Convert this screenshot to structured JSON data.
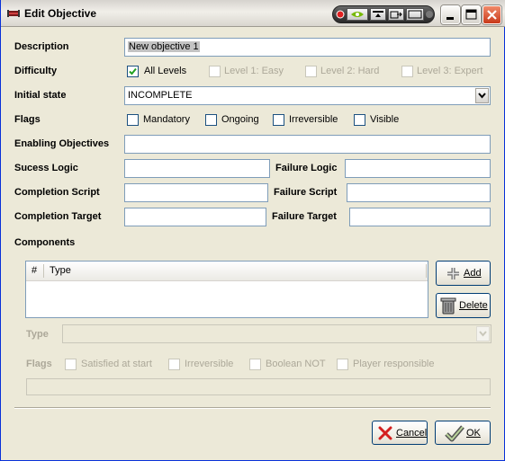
{
  "window": {
    "title": "Edit Objective"
  },
  "form": {
    "description": {
      "label": "Description",
      "value": "New objective 1"
    },
    "difficulty": {
      "label": "Difficulty",
      "options": [
        {
          "label": "All Levels",
          "checked": true,
          "enabled": true
        },
        {
          "label": "Level 1: Easy",
          "checked": false,
          "enabled": false
        },
        {
          "label": "Level 2: Hard",
          "checked": false,
          "enabled": false
        },
        {
          "label": "Level 3: Expert",
          "checked": false,
          "enabled": false
        }
      ]
    },
    "initial_state": {
      "label": "Initial state",
      "value": "INCOMPLETE"
    },
    "flags": {
      "label": "Flags",
      "options": [
        {
          "label": "Mandatory",
          "checked": false
        },
        {
          "label": "Ongoing",
          "checked": false
        },
        {
          "label": "Irreversible",
          "checked": false
        },
        {
          "label": "Visible",
          "checked": false
        }
      ]
    },
    "enabling_objectives": {
      "label": "Enabling Objectives",
      "value": ""
    },
    "success_logic": {
      "label": "Sucess Logic",
      "value": ""
    },
    "failure_logic": {
      "label": "Failure Logic",
      "value": ""
    },
    "completion_script": {
      "label": "Completion Script",
      "value": ""
    },
    "failure_script": {
      "label": "Failure Script",
      "value": ""
    },
    "completion_target": {
      "label": "Completion Target",
      "value": ""
    },
    "failure_target": {
      "label": "Failure Target",
      "value": ""
    }
  },
  "components": {
    "label": "Components",
    "columns": [
      "#",
      "Type"
    ],
    "rows": [],
    "add_button": "Add",
    "delete_button": "Delete",
    "type_label": "Type",
    "type_value": "",
    "flags_label": "Flags",
    "flag_options": [
      {
        "label": "Satisfied at start",
        "checked": false
      },
      {
        "label": "Irreversible",
        "checked": false
      },
      {
        "label": "Boolean NOT",
        "checked": false
      },
      {
        "label": "Player responsible",
        "checked": false
      }
    ],
    "extra_value": ""
  },
  "dialog_buttons": {
    "cancel": "Cancel",
    "ok": "OK"
  },
  "colors": {
    "window_bg": "#ece9d8",
    "field_border": "#7f9db9",
    "disabled_text": "#aca899",
    "close_red": "#c8391a"
  }
}
